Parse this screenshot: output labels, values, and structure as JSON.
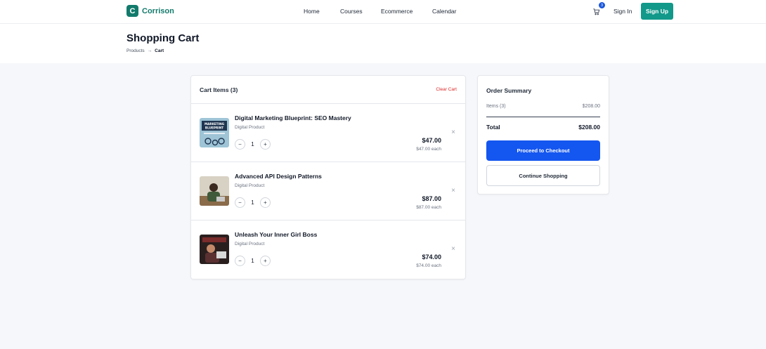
{
  "brand": {
    "logo_letter": "C",
    "name": "Corrison",
    "color": "#127a6b"
  },
  "nav": {
    "links": [
      "Home",
      "Courses",
      "Ecommerce",
      "Calendar"
    ]
  },
  "header": {
    "cart_count": "3",
    "sign_in": "Sign In",
    "sign_up": "Sign Up"
  },
  "page": {
    "title": "Shopping Cart",
    "breadcrumb": [
      "Products",
      "→",
      "Cart"
    ]
  },
  "cart": {
    "title": "Cart Items (3)",
    "clear_label": "Clear Cart",
    "items": [
      {
        "name": "Digital Marketing Blueprint: SEO Mastery",
        "type": "Digital Product",
        "quantity": "1",
        "price": "$47.00",
        "each": "$47.00 each",
        "thumb_text": "MARKETING BLUEPRINT"
      },
      {
        "name": "Advanced API Design Patterns",
        "type": "Digital Product",
        "quantity": "1",
        "price": "$87.00",
        "each": "$87.00 each"
      },
      {
        "name": "Unleash Your Inner Girl Boss",
        "type": "Digital Product",
        "quantity": "1",
        "price": "$74.00",
        "each": "$74.00 each"
      }
    ],
    "decrement": "−",
    "increment": "+",
    "remove": "×"
  },
  "summary": {
    "title": "Order Summary",
    "items_label": "Items (3)",
    "items_value": "$208.00",
    "total_label": "Total",
    "total_value": "$208.00",
    "checkout": "Proceed to Checkout",
    "continue": "Continue Shopping"
  },
  "colors": {
    "primary": "#1456f0",
    "accent": "#12998a",
    "danger": "#dc2626"
  }
}
